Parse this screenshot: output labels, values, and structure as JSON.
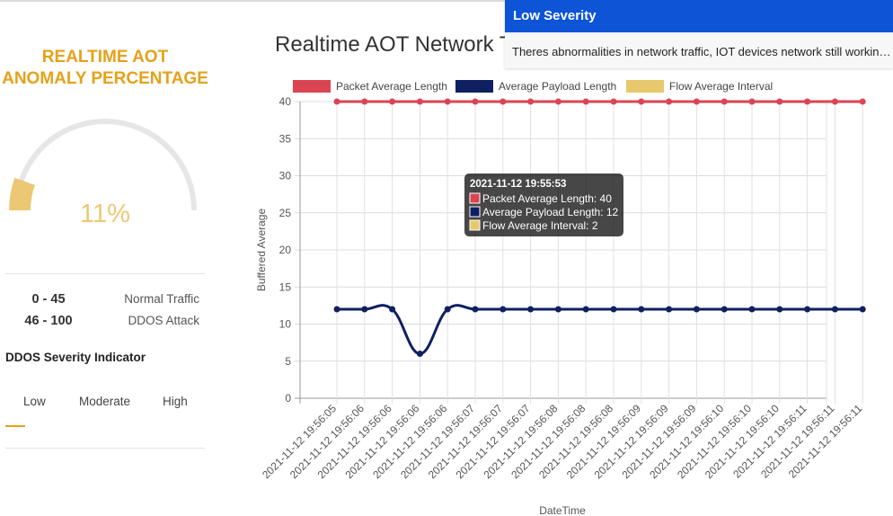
{
  "gauge": {
    "title_line1": "REALTIME AOT",
    "title_line2": "ANOMALY PERCENTAGE",
    "value_text": "11%",
    "value": 11,
    "max": 100,
    "fill_color": "#ecc874",
    "track_color": "#e6e6e6"
  },
  "ranges": [
    {
      "range": "0 - 45",
      "label": "Normal Traffic"
    },
    {
      "range": "46 - 100",
      "label": "DDOS Attack"
    }
  ],
  "severity": {
    "title": "DDOS Severity Indicator",
    "options": [
      "Low",
      "Moderate",
      "High"
    ],
    "selected": "Low",
    "accent": "#e6a11a"
  },
  "chart": {
    "title": "Realtime AOT Network T"
  },
  "notification": {
    "title": "Low Severity",
    "message": "Theres abnormalities in network traffic, IOT devices network still working...",
    "header_color": "#0d54d6"
  },
  "tooltip": {
    "title": "2021-11-12 19:55:53",
    "lines": [
      "Packet Average Length: 40",
      "Average Payload Length: 12",
      "Flow Average Interval: 2"
    ]
  },
  "chart_data": {
    "type": "line",
    "xlabel": "DateTime",
    "ylabel": "Buffered Average",
    "ylim": [
      0,
      40
    ],
    "yticks": [
      0,
      5,
      10,
      15,
      20,
      25,
      30,
      35,
      40
    ],
    "legend_position": "top",
    "categories": [
      "2021-11-12 19:56:05",
      "2021-11-12 19:56:06",
      "2021-11-12 19:56:06",
      "2021-11-12 19:56:06",
      "2021-11-12 19:56:06",
      "2021-11-12 19:56:07",
      "2021-11-12 19:56:07",
      "2021-11-12 19:56:07",
      "2021-11-12 19:56:08",
      "2021-11-12 19:56:08",
      "2021-11-12 19:56:08",
      "2021-11-12 19:56:09",
      "2021-11-12 19:56:09",
      "2021-11-12 19:56:09",
      "2021-11-12 19:56:10",
      "2021-11-12 19:56:10",
      "2021-11-12 19:56:10",
      "2021-11-12 19:56:11",
      "2021-11-12 19:56:11",
      "2021-11-12 19:56:11"
    ],
    "series": [
      {
        "name": "Packet Average Length",
        "color": "#dc4452",
        "values": [
          40,
          40,
          40,
          40,
          40,
          40,
          40,
          40,
          40,
          40,
          40,
          40,
          40,
          40,
          40,
          40,
          40,
          40,
          40,
          40
        ]
      },
      {
        "name": "Average Payload Length",
        "color": "#0e2062",
        "values": [
          12,
          12,
          12,
          6,
          12,
          12,
          12,
          12,
          12,
          12,
          12,
          12,
          12,
          12,
          12,
          12,
          12,
          12,
          12,
          12
        ]
      },
      {
        "name": "Flow Average Interval",
        "color": "#e8c86c",
        "values": []
      }
    ]
  }
}
